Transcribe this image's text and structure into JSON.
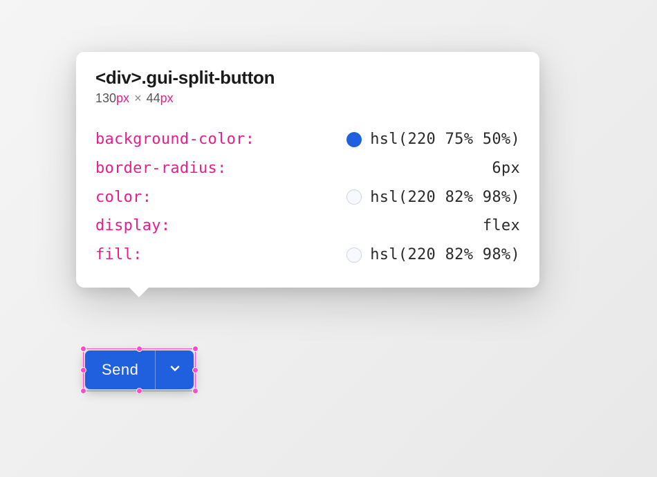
{
  "tooltip": {
    "element_tag": "<div>",
    "element_class": ".gui-split-button",
    "width_value": "130",
    "width_unit": "px",
    "dim_separator": "×",
    "height_value": "44",
    "height_unit": "px",
    "properties": [
      {
        "name": "background-color",
        "value": "hsl(220 75% 50%)",
        "swatch": "blue"
      },
      {
        "name": "border-radius",
        "value": "6px",
        "swatch": null
      },
      {
        "name": "color",
        "value": "hsl(220 82% 98%)",
        "swatch": "light"
      },
      {
        "name": "display",
        "value": "flex",
        "swatch": null
      },
      {
        "name": "fill",
        "value": "hsl(220 82% 98%)",
        "swatch": "light"
      }
    ]
  },
  "split_button": {
    "primary_label": "Send",
    "background_color": "hsl(220 75% 50%)",
    "text_color": "hsl(220 82% 98%)"
  },
  "selection": {
    "color": "#ff4dc9"
  }
}
